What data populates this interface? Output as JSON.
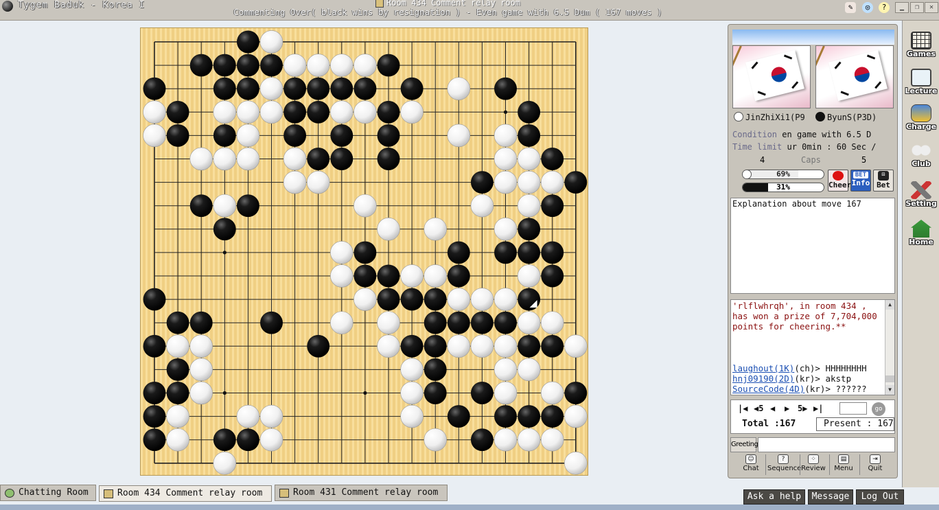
{
  "window": {
    "app_title": "Tygem Baduk - Korea I",
    "room_title": "Room 434 Comment relay room",
    "game_status": "Commenting Over( black wins by resignation ) - Even game with 6.5 Dum  ( 167 moves )"
  },
  "board": {
    "size": 19,
    "last_move": [
      16,
      11
    ],
    "black": [
      [
        4,
        0
      ],
      [
        2,
        1
      ],
      [
        3,
        1
      ],
      [
        4,
        1
      ],
      [
        5,
        1
      ],
      [
        10,
        1
      ],
      [
        0,
        2
      ],
      [
        3,
        2
      ],
      [
        4,
        2
      ],
      [
        6,
        2
      ],
      [
        7,
        2
      ],
      [
        8,
        2
      ],
      [
        9,
        2
      ],
      [
        11,
        2
      ],
      [
        15,
        2
      ],
      [
        1,
        3
      ],
      [
        6,
        3
      ],
      [
        7,
        3
      ],
      [
        10,
        3
      ],
      [
        16,
        3
      ],
      [
        1,
        4
      ],
      [
        3,
        4
      ],
      [
        6,
        4
      ],
      [
        8,
        4
      ],
      [
        10,
        4
      ],
      [
        16,
        4
      ],
      [
        7,
        5
      ],
      [
        8,
        5
      ],
      [
        10,
        5
      ],
      [
        17,
        5
      ],
      [
        14,
        6
      ],
      [
        18,
        6
      ],
      [
        2,
        7
      ],
      [
        4,
        7
      ],
      [
        17,
        7
      ],
      [
        3,
        8
      ],
      [
        16,
        8
      ],
      [
        9,
        9
      ],
      [
        13,
        9
      ],
      [
        15,
        9
      ],
      [
        16,
        9
      ],
      [
        17,
        9
      ],
      [
        9,
        10
      ],
      [
        10,
        10
      ],
      [
        13,
        10
      ],
      [
        17,
        10
      ],
      [
        0,
        11
      ],
      [
        10,
        11
      ],
      [
        11,
        11
      ],
      [
        12,
        11
      ],
      [
        16,
        11
      ],
      [
        1,
        12
      ],
      [
        2,
        12
      ],
      [
        5,
        12
      ],
      [
        12,
        12
      ],
      [
        13,
        12
      ],
      [
        14,
        12
      ],
      [
        15,
        12
      ],
      [
        0,
        13
      ],
      [
        7,
        13
      ],
      [
        11,
        13
      ],
      [
        12,
        13
      ],
      [
        16,
        13
      ],
      [
        17,
        13
      ],
      [
        1,
        14
      ],
      [
        12,
        14
      ],
      [
        0,
        15
      ],
      [
        1,
        15
      ],
      [
        12,
        15
      ],
      [
        14,
        15
      ],
      [
        18,
        15
      ],
      [
        0,
        16
      ],
      [
        13,
        16
      ],
      [
        15,
        16
      ],
      [
        16,
        16
      ],
      [
        17,
        16
      ],
      [
        0,
        17
      ],
      [
        3,
        17
      ],
      [
        4,
        17
      ],
      [
        14,
        17
      ]
    ],
    "white": [
      [
        5,
        0
      ],
      [
        6,
        1
      ],
      [
        7,
        1
      ],
      [
        8,
        1
      ],
      [
        9,
        1
      ],
      [
        5,
        2
      ],
      [
        13,
        2
      ],
      [
        0,
        3
      ],
      [
        3,
        3
      ],
      [
        4,
        3
      ],
      [
        5,
        3
      ],
      [
        8,
        3
      ],
      [
        9,
        3
      ],
      [
        11,
        3
      ],
      [
        0,
        4
      ],
      [
        4,
        4
      ],
      [
        13,
        4
      ],
      [
        15,
        4
      ],
      [
        2,
        5
      ],
      [
        3,
        5
      ],
      [
        4,
        5
      ],
      [
        6,
        5
      ],
      [
        15,
        5
      ],
      [
        16,
        5
      ],
      [
        6,
        6
      ],
      [
        7,
        6
      ],
      [
        15,
        6
      ],
      [
        16,
        6
      ],
      [
        17,
        6
      ],
      [
        3,
        7
      ],
      [
        9,
        7
      ],
      [
        14,
        7
      ],
      [
        16,
        7
      ],
      [
        10,
        8
      ],
      [
        12,
        8
      ],
      [
        15,
        8
      ],
      [
        8,
        9
      ],
      [
        8,
        10
      ],
      [
        11,
        10
      ],
      [
        12,
        10
      ],
      [
        16,
        10
      ],
      [
        9,
        11
      ],
      [
        13,
        11
      ],
      [
        14,
        11
      ],
      [
        15,
        11
      ],
      [
        8,
        12
      ],
      [
        10,
        12
      ],
      [
        16,
        12
      ],
      [
        17,
        12
      ],
      [
        1,
        13
      ],
      [
        2,
        13
      ],
      [
        10,
        13
      ],
      [
        13,
        13
      ],
      [
        14,
        13
      ],
      [
        15,
        13
      ],
      [
        18,
        13
      ],
      [
        2,
        14
      ],
      [
        11,
        14
      ],
      [
        15,
        14
      ],
      [
        16,
        14
      ],
      [
        2,
        15
      ],
      [
        11,
        15
      ],
      [
        15,
        15
      ],
      [
        17,
        15
      ],
      [
        1,
        16
      ],
      [
        4,
        16
      ],
      [
        5,
        16
      ],
      [
        11,
        16
      ],
      [
        18,
        16
      ],
      [
        1,
        17
      ],
      [
        5,
        17
      ],
      [
        12,
        17
      ],
      [
        15,
        17
      ],
      [
        16,
        17
      ],
      [
        17,
        17
      ],
      [
        3,
        18
      ],
      [
        18,
        18
      ]
    ]
  },
  "players": {
    "white_name": "JinZhiXi1(P9",
    "black_name": "ByunS(P3D)"
  },
  "info": {
    "condition_label": "Condition",
    "condition_value": "en game with 6.5 D",
    "time_label": "Time limit",
    "time_value": "ur 0min : 60 Sec /",
    "caps_label": "Caps",
    "caps_white": "4",
    "caps_black": "5",
    "white_pct_text": "69%",
    "white_pct": 69,
    "black_pct_text": "31%",
    "black_pct": 31,
    "cheer_label": "Cheer",
    "betinfo_badge": "BET",
    "betinfo_label": "Info",
    "bet_label": "Bet"
  },
  "explanation": "Explanation about move 167",
  "chat": {
    "notice": "'rlflwhrqh', in room 434 , has won a prize of 7,704,000 points for cheering.**",
    "lines": [
      {
        "nick": "laughout(1K)",
        "rest": "(ch)> HHHHHHHH"
      },
      {
        "nick": "hnj09190(2D)",
        "rest": "(kr)> akstp"
      },
      {
        "nick": "SourceCode(4D)",
        "rest": "(kr)> ??????"
      }
    ]
  },
  "nav": {
    "first": "|◀",
    "back5": "◀5",
    "prev": "◀",
    "next": "▶",
    "fwd5": "5▶",
    "last": "▶|",
    "go": "go",
    "total": "Total :167",
    "present": "Present : 167"
  },
  "greeting_label": "Greeting",
  "actions": [
    "Chat",
    "Sequence",
    "Review",
    "Menu",
    "Quit"
  ],
  "sidebar": [
    "Games",
    "Lecture",
    "Charge",
    "Club",
    "Setting",
    "Home"
  ],
  "tabs": [
    "Chatting Room",
    "Room 434 Comment relay room",
    "Room 431 Comment relay room"
  ],
  "footer_buttons": [
    "Ask a help",
    "Message",
    "Log Out"
  ]
}
